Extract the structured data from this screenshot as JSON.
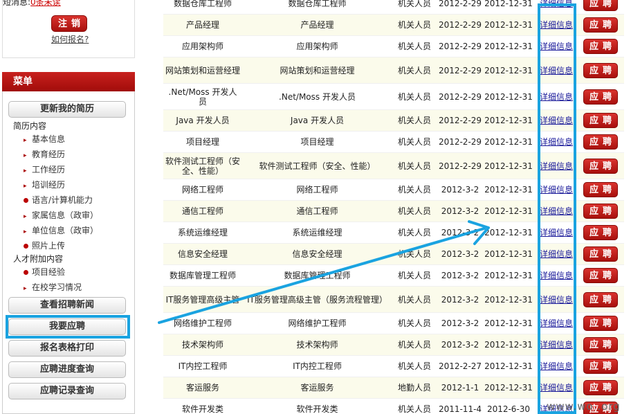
{
  "left": {
    "notice": "短消息:",
    "notice_count": "0条未读",
    "logout": "注销",
    "howto": "如何报名?",
    "menu_title": "菜单",
    "update_resume": "更新我的简历",
    "resume_section": "简历内容",
    "resume_items": [
      "基本信息",
      "教育经历",
      "工作经历",
      "培训经历",
      "语言/计算机能力",
      "家属信息（政审）",
      "单位信息（政审）",
      "照片上传"
    ],
    "extra_section": "人才附加内容",
    "extra_items": [
      "项目经验",
      "在校学习情况"
    ],
    "buttons": [
      "查看招聘新闻",
      "我要应聘",
      "报名表格打印",
      "应聘进度查询",
      "应聘记录查询"
    ]
  },
  "table": {
    "detail_label": "详细信息",
    "apply_label": "应聘",
    "rows": [
      {
        "title": "数据仓库工程师",
        "full": "数据仓库工程师",
        "type": "机关人员",
        "start": "2012-2-29",
        "end": "2012-12-31"
      },
      {
        "title": "产品经理",
        "full": "产品经理",
        "type": "机关人员",
        "start": "2012-2-29",
        "end": "2012-12-31"
      },
      {
        "title": "应用架构师",
        "full": "应用架构师",
        "type": "机关人员",
        "start": "2012-2-29",
        "end": "2012-12-31"
      },
      {
        "title": "网站策划和运营经理",
        "full": "网站策划和运营经理",
        "type": "机关人员",
        "start": "2012-2-29",
        "end": "2012-12-31"
      },
      {
        "title": ".Net/Moss 开发人员",
        "full": ".Net/Moss 开发人员",
        "type": "机关人员",
        "start": "2012-2-29",
        "end": "2012-12-31"
      },
      {
        "title": "Java 开发人员",
        "full": "Java 开发人员",
        "type": "机关人员",
        "start": "2012-2-29",
        "end": "2012-12-31"
      },
      {
        "title": "项目经理",
        "full": "项目经理",
        "type": "机关人员",
        "start": "2012-2-29",
        "end": "2012-12-31"
      },
      {
        "title": "软件测试工程师（安全、性能）",
        "full": "软件测试工程师（安全、性能）",
        "type": "机关人员",
        "start": "2012-2-29",
        "end": "2012-12-31"
      },
      {
        "title": "网络工程师",
        "full": "网络工程师",
        "type": "机关人员",
        "start": "2012-3-2",
        "end": "2012-12-31"
      },
      {
        "title": "通信工程师",
        "full": "通信工程师",
        "type": "机关人员",
        "start": "2012-3-2",
        "end": "2012-12-31"
      },
      {
        "title": "系统运维经理",
        "full": "系统运维经理",
        "type": "机关人员",
        "start": "2012-3-2",
        "end": "2012-12-31"
      },
      {
        "title": "信息安全经理",
        "full": "信息安全经理",
        "type": "机关人员",
        "start": "2012-3-2",
        "end": "2012-12-31"
      },
      {
        "title": "数据库管理工程师",
        "full": "数据库管理工程师",
        "type": "机关人员",
        "start": "2012-3-2",
        "end": "2012-12-31"
      },
      {
        "title": "IT服务管理高级主管",
        "full": "IT服务管理高级主管（服务流程管理）",
        "type": "机关人员",
        "start": "2012-3-2",
        "end": "2012-12-31"
      },
      {
        "title": "网络维护工程师",
        "full": "网络维护工程师",
        "type": "机关人员",
        "start": "2012-3-2",
        "end": "2012-12-31"
      },
      {
        "title": "技术架构师",
        "full": "技术架构师",
        "type": "机关人员",
        "start": "2012-3-2",
        "end": "2012-12-31"
      },
      {
        "title": "IT内控工程师",
        "full": "IT内控工程师",
        "type": "机关人员",
        "start": "2012-2-27",
        "end": "2012-12-31"
      },
      {
        "title": "客运服务",
        "full": "客运服务",
        "type": "地勤人员",
        "start": "2012-1-1",
        "end": "2012-12-31"
      },
      {
        "title": "软件开发类",
        "full": "软件开发类",
        "type": "机关人员",
        "start": "2011-11-4",
        "end": "2012-6-30"
      }
    ]
  },
  "watermark": "www.wo   .org",
  "colors": {
    "accent_red": "#b3120f",
    "highlight_blue": "#1aa3e0",
    "link": "#1a1a9a"
  }
}
